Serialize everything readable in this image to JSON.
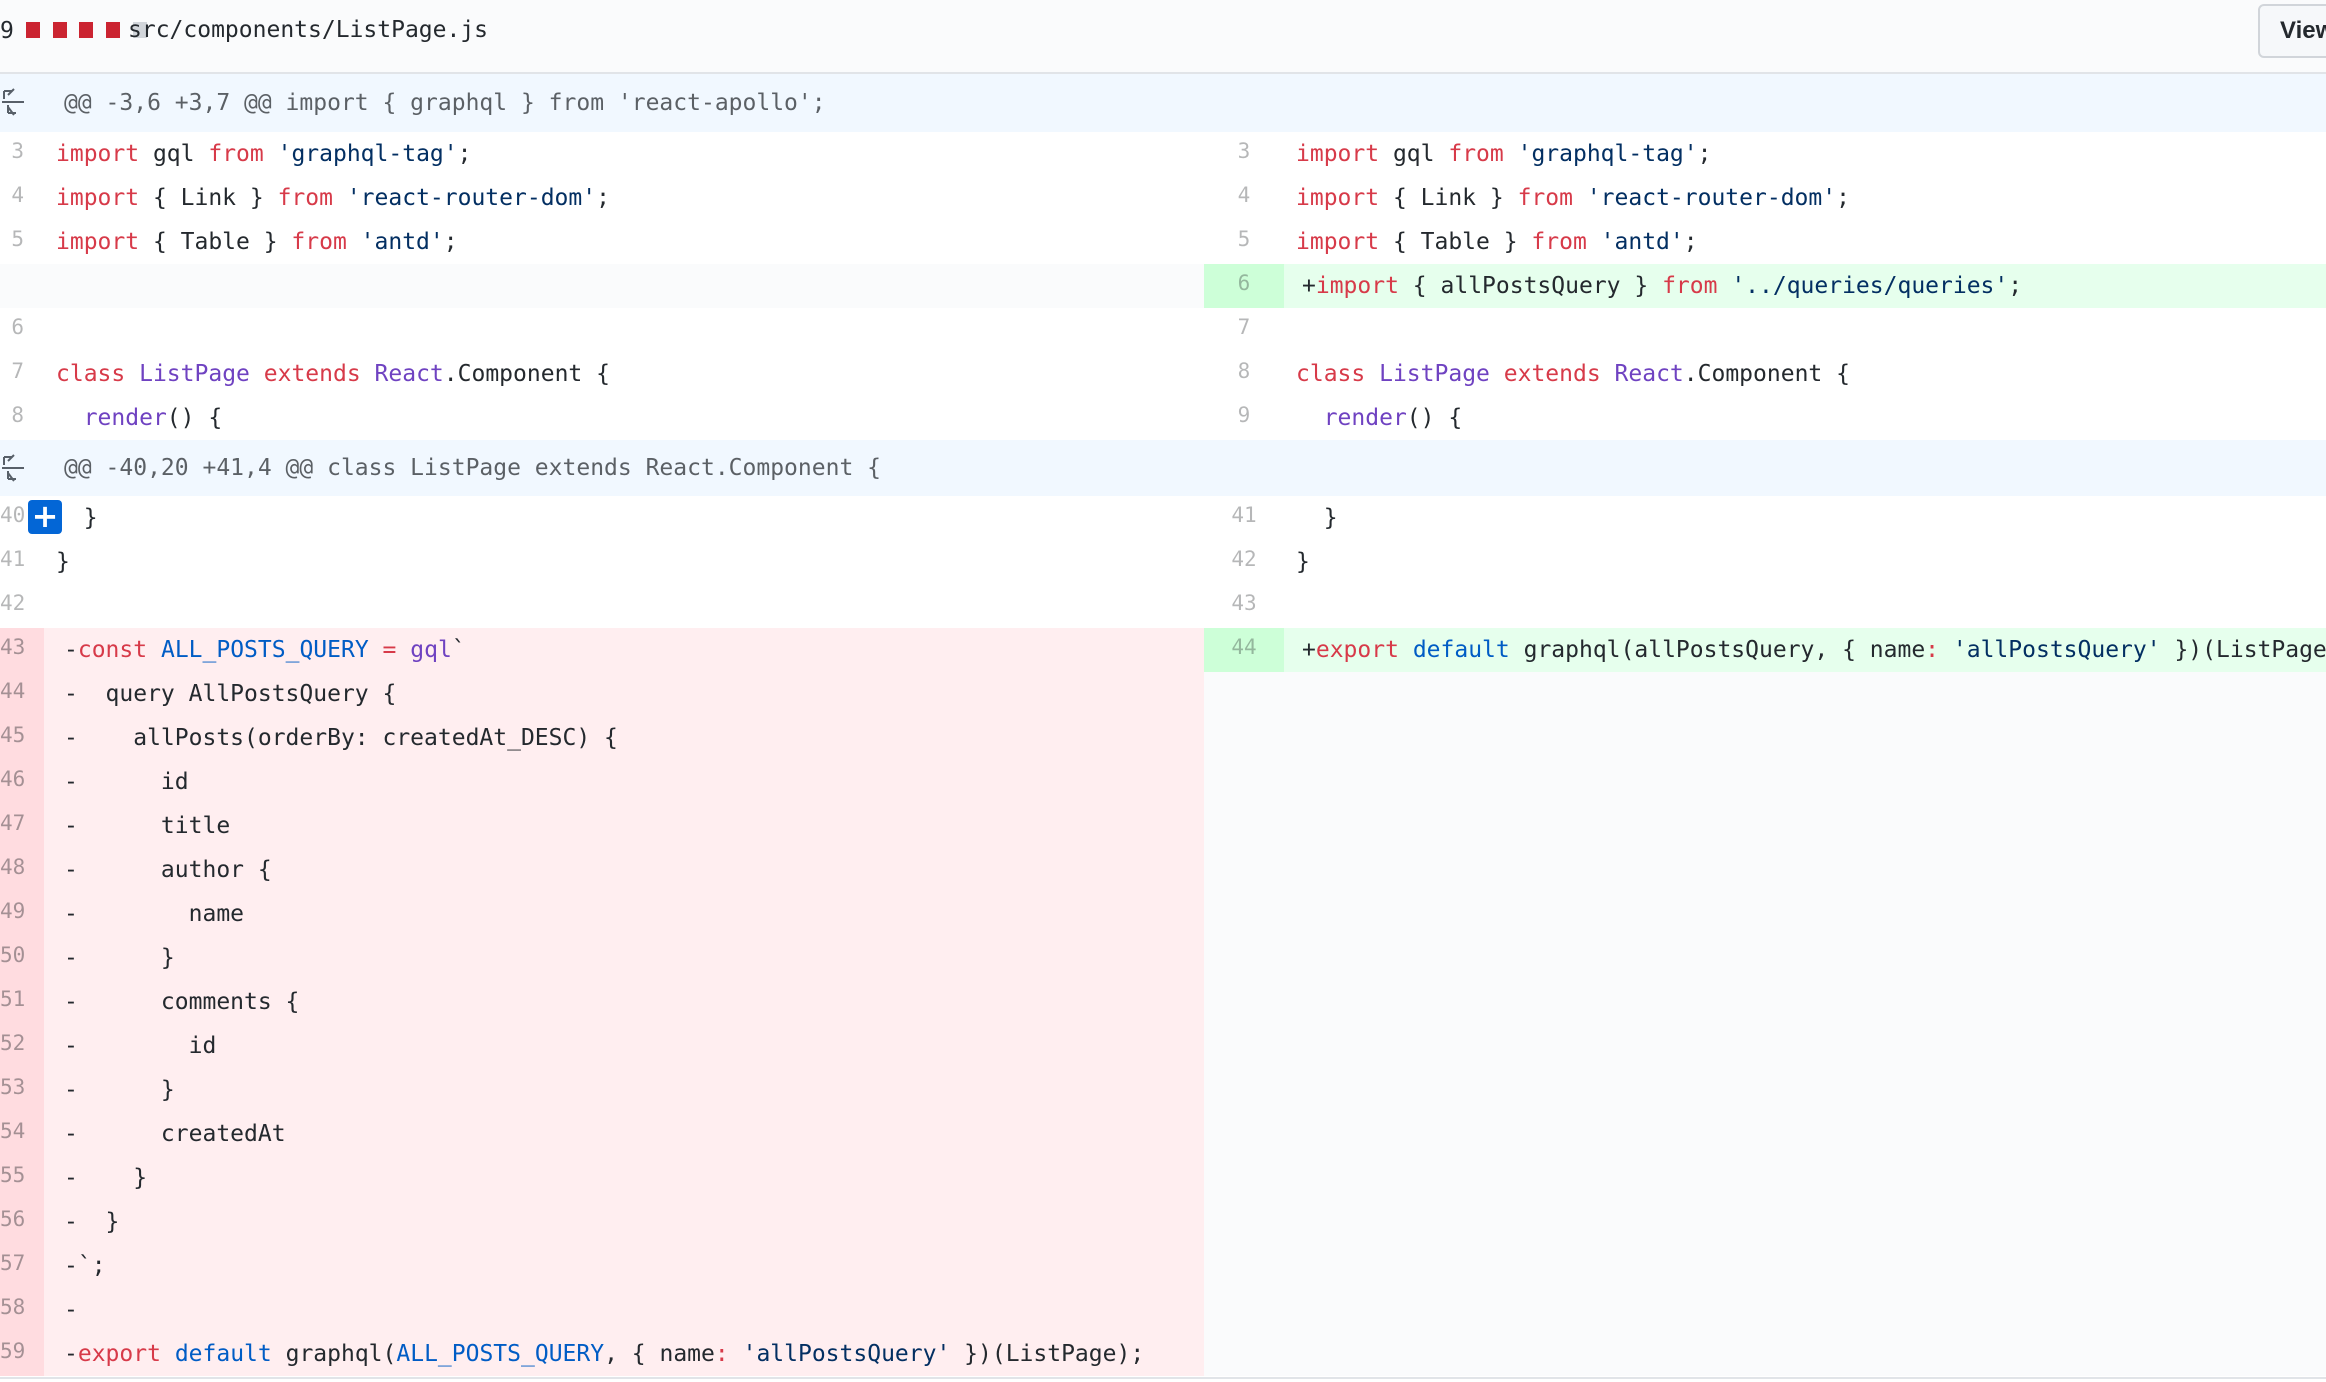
{
  "file": {
    "diffstat_number": "9",
    "diffstat_blocks": [
      "#cb2431",
      "#cb2431",
      "#cb2431",
      "#cb2431",
      "#d1d5da"
    ],
    "path": "src/components/ListPage.js",
    "view_button_label": "View"
  },
  "colors": {
    "keyword": "#d73a49",
    "entity": "#6f42c1",
    "string": "#032f62",
    "constant": "#005cc5",
    "deletion_bg": "#ffeef0",
    "addition_bg": "#e6ffed",
    "hunk_bg": "#f1f8ff"
  },
  "icons": {
    "hunk_expand": "unfold-icon",
    "add_comment": "plus-icon"
  },
  "hunks": [
    {
      "header": "@@ -3,6 +3,7 @@ import { graphql } from 'react-apollo';"
    },
    {
      "header": "@@ -40,20 +41,4 @@ class ListPage extends React.Component {"
    }
  ],
  "rows": [
    {
      "left_num": "3",
      "left_code": "import gql from 'graphql-tag';",
      "right_num": "3",
      "right_code": "import gql from 'graphql-tag';"
    },
    {
      "left_num": "4",
      "left_code": "import { Link } from 'react-router-dom';",
      "right_num": "4",
      "right_code": "import { Link } from 'react-router-dom';"
    },
    {
      "left_num": "5",
      "left_code": "import { Table } from 'antd';",
      "right_num": "5",
      "right_code": "import { Table } from 'antd';"
    },
    {
      "left_num": "",
      "left_code": "",
      "right_num": "6",
      "right_code": "+import { allPostsQuery } from '../queries/queries';"
    },
    {
      "left_num": "6",
      "left_code": "",
      "right_num": "7",
      "right_code": ""
    },
    {
      "left_num": "7",
      "left_code": "class ListPage extends React.Component {",
      "right_num": "8",
      "right_code": "class ListPage extends React.Component {"
    },
    {
      "left_num": "8",
      "left_code": "  render() {",
      "right_num": "9",
      "right_code": "  render() {"
    },
    {
      "left_num": "40",
      "left_code": "  }",
      "right_num": "41",
      "right_code": "  }"
    },
    {
      "left_num": "41",
      "left_code": "}",
      "right_num": "42",
      "right_code": "}"
    },
    {
      "left_num": "42",
      "left_code": "",
      "right_num": "43",
      "right_code": ""
    },
    {
      "left_num": "43",
      "left_code": "-const ALL_POSTS_QUERY = gql`",
      "right_num": "44",
      "right_code": "+export default graphql(allPostsQuery, { name: 'allPostsQuery' })(ListPage);"
    },
    {
      "left_num": "44",
      "left_code": "-  query AllPostsQuery {"
    },
    {
      "left_num": "45",
      "left_code": "-    allPosts(orderBy: createdAt_DESC) {"
    },
    {
      "left_num": "46",
      "left_code": "-      id"
    },
    {
      "left_num": "47",
      "left_code": "-      title"
    },
    {
      "left_num": "48",
      "left_code": "-      author {"
    },
    {
      "left_num": "49",
      "left_code": "-        name"
    },
    {
      "left_num": "50",
      "left_code": "-      }"
    },
    {
      "left_num": "51",
      "left_code": "-      comments {"
    },
    {
      "left_num": "52",
      "left_code": "-        id"
    },
    {
      "left_num": "53",
      "left_code": "-      }"
    },
    {
      "left_num": "54",
      "left_code": "-      createdAt"
    },
    {
      "left_num": "55",
      "left_code": "-    }"
    },
    {
      "left_num": "56",
      "left_code": "-  }"
    },
    {
      "left_num": "57",
      "left_code": "-`;"
    },
    {
      "left_num": "58",
      "left_code": "-"
    },
    {
      "left_num": "59",
      "left_code": "-export default graphql(ALL_POSTS_QUERY, { name: 'allPostsQuery' })(ListPage);"
    }
  ]
}
